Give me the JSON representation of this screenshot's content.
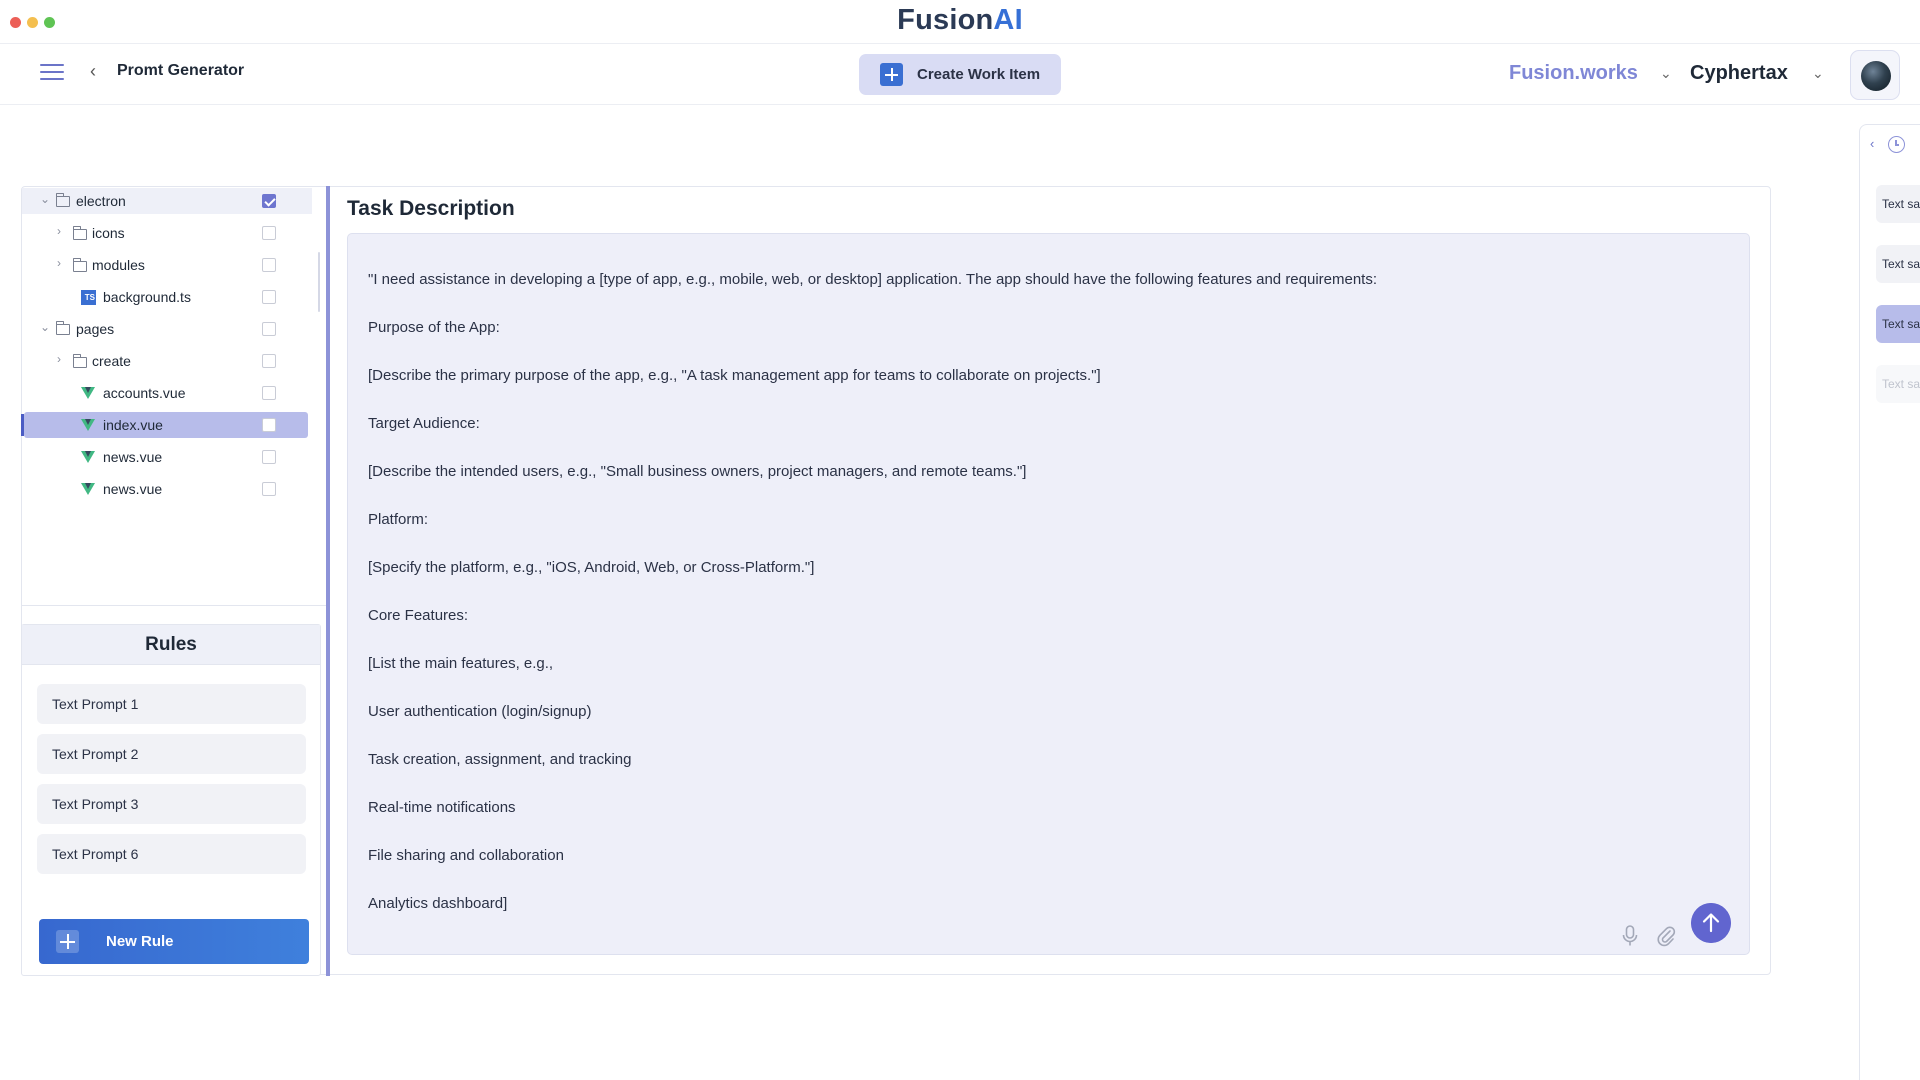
{
  "app": {
    "logo_part1": "Fusion",
    "logo_part2": "AI"
  },
  "header": {
    "page_title": "Promt Generator",
    "create_button": "Create Work Item",
    "workspace_1": "Fusion.works",
    "workspace_2": "Cyphertax"
  },
  "tree": {
    "items": [
      {
        "label": "electron",
        "type": "folder",
        "expanded": true,
        "checked": true
      },
      {
        "label": "icons",
        "type": "folder",
        "expanded": false,
        "checked": false
      },
      {
        "label": "modules",
        "type": "folder",
        "expanded": false,
        "checked": false
      },
      {
        "label": "background.ts",
        "type": "ts-file",
        "checked": false
      },
      {
        "label": "pages",
        "type": "folder",
        "expanded": true,
        "checked": false
      },
      {
        "label": "create",
        "type": "folder",
        "expanded": false,
        "checked": false
      },
      {
        "label": "accounts.vue",
        "type": "vue-file",
        "checked": false
      },
      {
        "label": "index.vue",
        "type": "vue-file",
        "checked": false,
        "selected": true
      },
      {
        "label": "news.vue",
        "type": "vue-file",
        "checked": false
      },
      {
        "label": "news.vue",
        "type": "vue-file",
        "checked": false
      }
    ]
  },
  "rules": {
    "title": "Rules",
    "items": [
      "Text Prompt 1",
      "Text Prompt 2",
      "Text Prompt 3",
      "Text Prompt 6"
    ],
    "new_rule": "New Rule"
  },
  "task": {
    "title": "Task Description",
    "lines": [
      "\"I need assistance in developing a [type of app, e.g., mobile, web, or desktop] application. The app should have the following features and requirements:",
      "Purpose of the App:",
      "[Describe the primary purpose of the app, e.g., \"A task management app for teams to collaborate on projects.\"]",
      "Target Audience:",
      "[Describe the intended users, e.g., \"Small business owners, project managers, and remote teams.\"]",
      "Platform:",
      "[Specify the platform, e.g., \"iOS, Android, Web, or Cross-Platform.\"]",
      "Core Features:",
      "[List the main features, e.g.,",
      "User authentication (login/signup)",
      "Task creation, assignment, and tracking",
      "Real-time notifications",
      "File sharing and collaboration",
      "Analytics dashboard]"
    ]
  },
  "history": {
    "items": [
      "Text sa",
      "Text sa",
      "Text sa",
      "Text sa"
    ]
  }
}
